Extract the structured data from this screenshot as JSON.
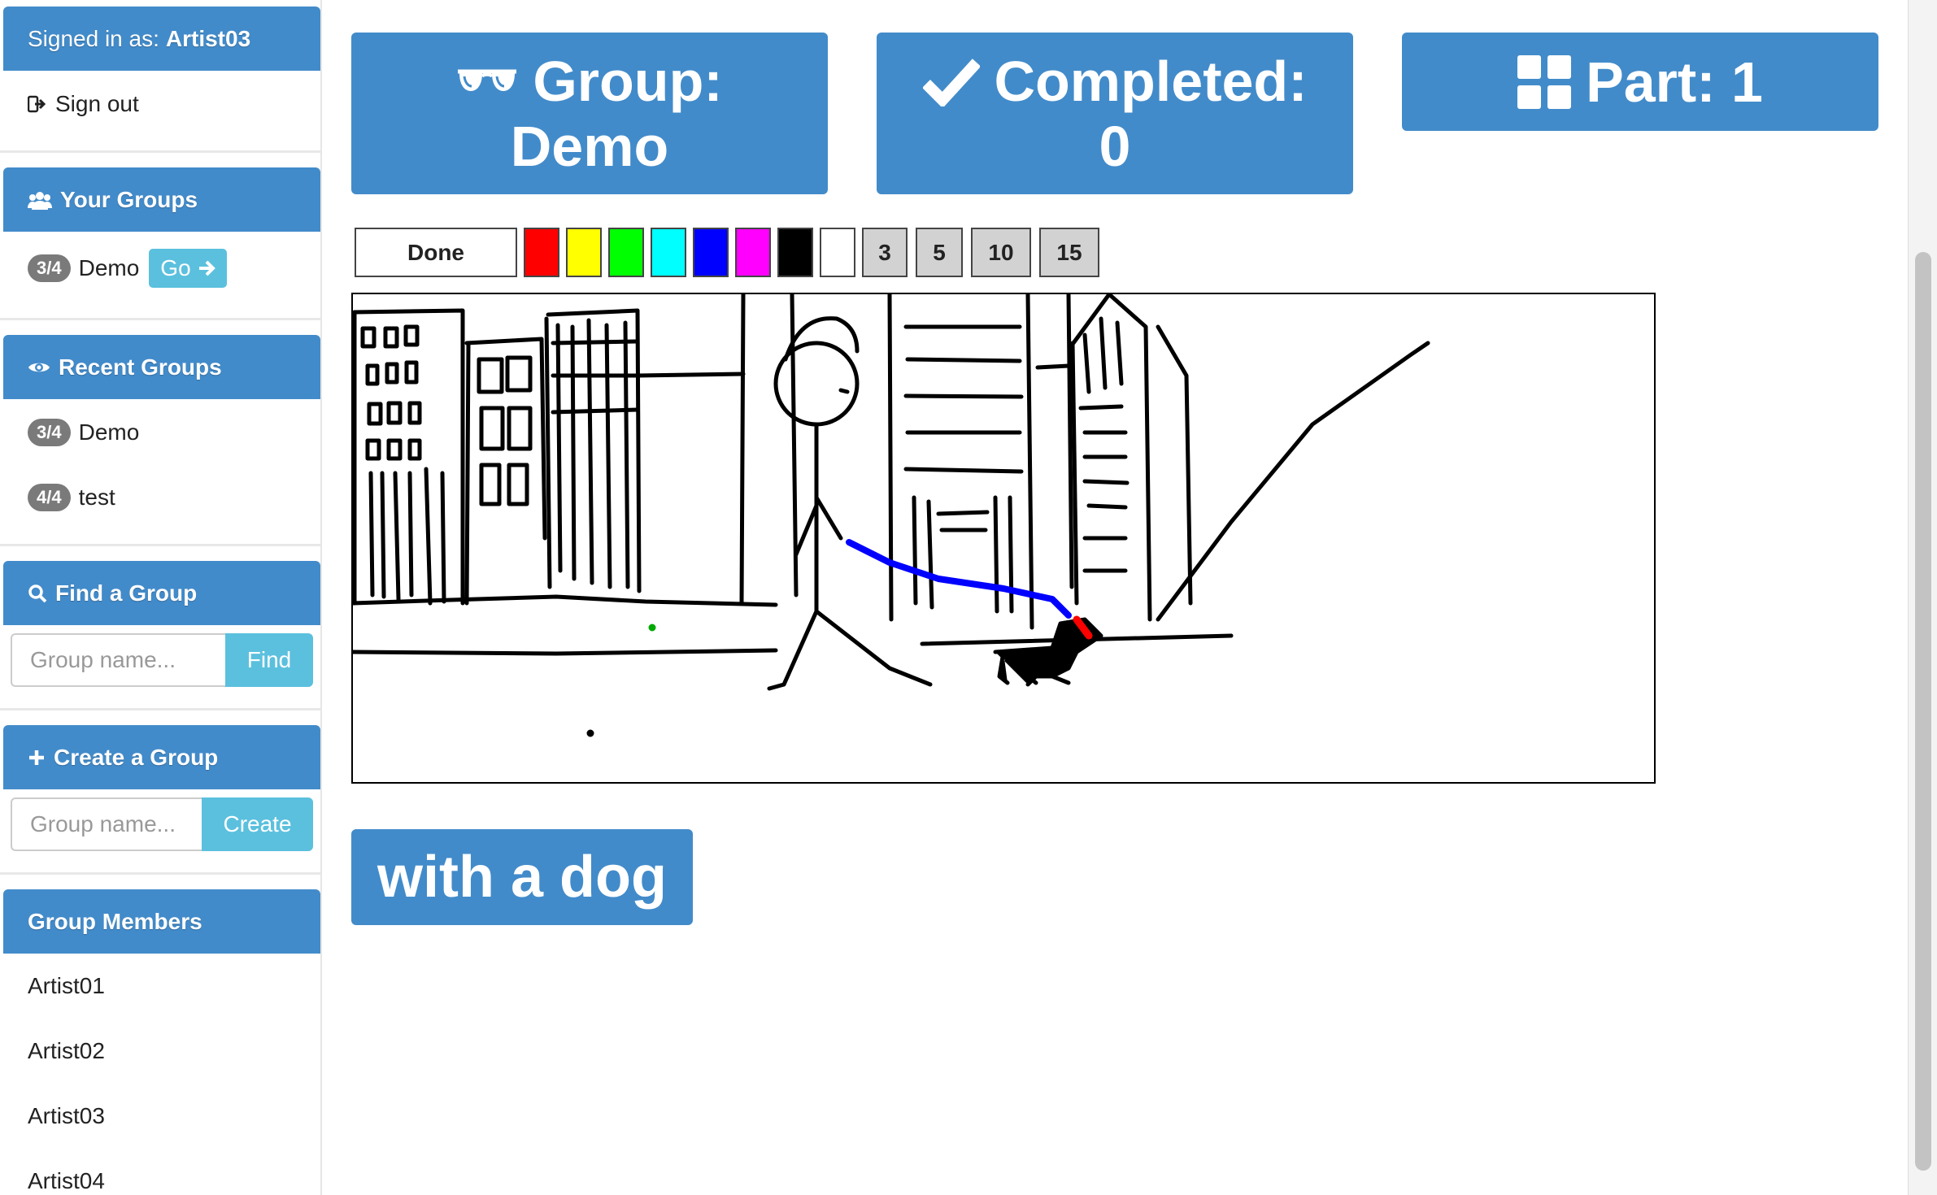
{
  "sidebar": {
    "signed_in_prefix": "Signed in as:",
    "username": "Artist03",
    "sign_out": "Sign out",
    "your_groups": {
      "title": "Your Groups",
      "items": [
        {
          "badge": "3/4",
          "name": "Demo",
          "action": "Go"
        }
      ]
    },
    "recent_groups": {
      "title": "Recent Groups",
      "items": [
        {
          "badge": "3/4",
          "name": "Demo"
        },
        {
          "badge": "4/4",
          "name": "test"
        }
      ]
    },
    "find_group": {
      "title": "Find a Group",
      "placeholder": "Group name...",
      "button": "Find"
    },
    "create_group": {
      "title": "Create a Group",
      "placeholder": "Group name...",
      "button": "Create"
    },
    "members": {
      "title": "Group Members",
      "items": [
        "Artist01",
        "Artist02",
        "Artist03",
        "Artist04"
      ]
    }
  },
  "stats": {
    "group_label": "Group:",
    "group_value": "Demo",
    "completed_label": "Completed:",
    "completed_value": "0",
    "part_label": "Part: 1"
  },
  "toolbar": {
    "done_label": "Done",
    "colors": [
      "#ff0000",
      "#ffff00",
      "#00ff00",
      "#00ffff",
      "#0000ff",
      "#ff00ff",
      "#000000",
      "#ffffff"
    ],
    "sizes": [
      "3",
      "5",
      "10",
      "15"
    ]
  },
  "prompt": {
    "text": "with a dog"
  },
  "theme": {
    "primary": "#428bca",
    "info": "#5bc0de",
    "badge": "#7a7a7a"
  }
}
